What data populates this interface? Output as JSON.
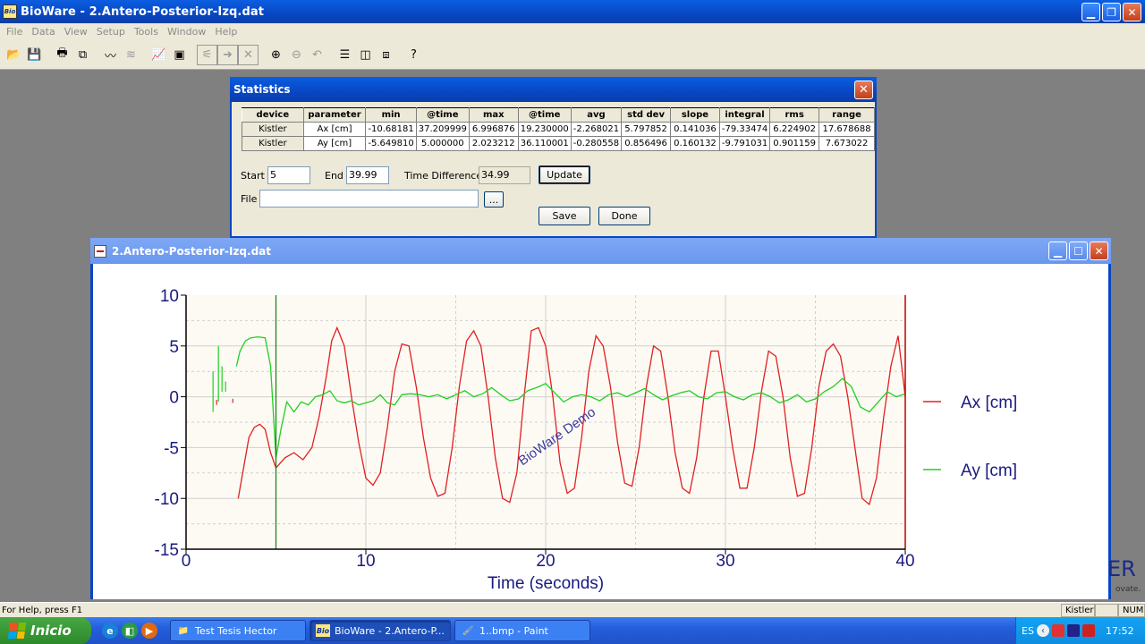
{
  "window": {
    "title": "BioWare - 2.Antero-Posterior-Izq.dat",
    "app_icon_text": "Bio"
  },
  "menu": [
    "File",
    "Data",
    "View",
    "Setup",
    "Tools",
    "Window",
    "Help"
  ],
  "statistics": {
    "title": "Statistics",
    "columns": [
      "device",
      "parameter",
      "min",
      "@time",
      "max",
      "@time",
      "avg",
      "std dev",
      "slope",
      "integral",
      "rms",
      "range"
    ],
    "rows": [
      [
        "Kistler",
        "Ax [cm]",
        "-10.68181",
        "37.209999",
        "6.996876",
        "19.230000",
        "-2.268021",
        "5.797852",
        "0.141036",
        "-79.33474",
        "6.224902",
        "17.678688"
      ],
      [
        "Kistler",
        "Ay [cm]",
        "-5.649810",
        "5.000000",
        "2.023212",
        "36.110001",
        "-0.280558",
        "0.856496",
        "0.160132",
        "-9.791031",
        "0.901159",
        "7.673022"
      ]
    ],
    "start_label": "Start",
    "start_value": "5",
    "end_label": "End",
    "end_value": "39.99",
    "time_diff_label": "Time Difference",
    "time_diff_value": "34.99",
    "update_label": "Update",
    "file_label": "File",
    "file_value": "",
    "browse_label": "...",
    "save_label": "Save",
    "done_label": "Done"
  },
  "plot_window": {
    "title": "2.Antero-Posterior-Izq.dat",
    "partial_logo": "ER",
    "partial_tagline": "ovate."
  },
  "chart_data": {
    "type": "line",
    "xlabel": "Time (seconds)",
    "ylabel": "",
    "xlim": [
      0,
      40
    ],
    "ylim": [
      -15,
      10
    ],
    "xticks": [
      0,
      10,
      20,
      30,
      40
    ],
    "yticks": [
      10,
      5,
      0,
      -5,
      -10,
      -15
    ],
    "grid": true,
    "legend": "right",
    "watermark": "BioWare Demo",
    "cursors": [
      5,
      40
    ],
    "series": [
      {
        "name": "Ax [cm]",
        "color": "#e02020",
        "x": [
          2.9,
          3.2,
          3.5,
          3.8,
          4.1,
          4.4,
          4.7,
          5.0,
          5.5,
          6.0,
          6.5,
          7.0,
          7.4,
          7.8,
          8.1,
          8.4,
          8.8,
          9.2,
          9.6,
          10.0,
          10.4,
          10.8,
          11.2,
          11.6,
          12.0,
          12.4,
          12.8,
          13.2,
          13.6,
          14.0,
          14.4,
          14.8,
          15.2,
          15.6,
          16.0,
          16.4,
          16.8,
          17.2,
          17.6,
          18.0,
          18.4,
          18.8,
          19.2,
          19.6,
          20.0,
          20.4,
          20.8,
          21.2,
          21.6,
          22.0,
          22.4,
          22.8,
          23.2,
          23.6,
          24.0,
          24.4,
          24.8,
          25.2,
          25.6,
          26.0,
          26.4,
          26.8,
          27.2,
          27.6,
          28.0,
          28.4,
          28.8,
          29.2,
          29.6,
          30.0,
          30.4,
          30.8,
          31.2,
          31.6,
          32.0,
          32.4,
          32.8,
          33.2,
          33.6,
          34.0,
          34.4,
          34.8,
          35.2,
          35.6,
          36.0,
          36.4,
          36.8,
          37.2,
          37.6,
          38.0,
          38.4,
          38.8,
          39.2,
          39.6,
          40.0
        ],
        "y": [
          -10.0,
          -7.0,
          -4.0,
          -3.0,
          -2.7,
          -3.2,
          -5.5,
          -7.0,
          -6.0,
          -5.5,
          -6.2,
          -5.0,
          -2.0,
          2.0,
          5.5,
          6.8,
          5.0,
          0.0,
          -4.5,
          -8.0,
          -8.7,
          -7.5,
          -3.0,
          2.5,
          5.2,
          5.0,
          1.0,
          -4.0,
          -8.0,
          -9.8,
          -9.5,
          -5.0,
          1.0,
          5.5,
          6.5,
          5.0,
          0.0,
          -6.0,
          -10.0,
          -10.4,
          -7.5,
          0.0,
          6.5,
          6.8,
          5.0,
          0.0,
          -6.5,
          -9.5,
          -9.0,
          -4.0,
          2.5,
          6.0,
          5.0,
          1.0,
          -4.5,
          -8.5,
          -8.8,
          -5.0,
          1.0,
          5.0,
          4.5,
          0.0,
          -5.5,
          -9.0,
          -9.5,
          -6.0,
          0.0,
          4.5,
          4.5,
          0.0,
          -5.0,
          -9.0,
          -9.0,
          -5.0,
          0.5,
          4.5,
          4.0,
          0.0,
          -6.0,
          -9.8,
          -9.5,
          -5.0,
          1.0,
          4.5,
          5.2,
          4.0,
          0.0,
          -5.0,
          -10.0,
          -10.6,
          -8.0,
          -2.0,
          3.0,
          6.0,
          0.0
        ]
      },
      {
        "name": "Ay [cm]",
        "color": "#20d020",
        "x": [
          2.8,
          3.0,
          3.3,
          3.6,
          4.0,
          4.4,
          4.7,
          5.0,
          5.3,
          5.6,
          6.0,
          6.4,
          6.8,
          7.2,
          7.6,
          8.0,
          8.4,
          8.8,
          9.2,
          9.6,
          10.0,
          10.4,
          10.8,
          11.2,
          11.6,
          12.0,
          12.5,
          13.0,
          13.5,
          14.0,
          14.5,
          15.0,
          15.5,
          16.0,
          16.5,
          17.0,
          17.5,
          18.0,
          18.5,
          19.0,
          19.5,
          20.0,
          20.5,
          21.0,
          21.5,
          22.0,
          22.5,
          23.0,
          23.5,
          24.0,
          24.5,
          25.0,
          25.5,
          26.0,
          26.5,
          27.0,
          27.5,
          28.0,
          28.5,
          29.0,
          29.5,
          30.0,
          30.5,
          31.0,
          31.5,
          32.0,
          32.5,
          33.0,
          33.5,
          34.0,
          34.5,
          35.0,
          35.5,
          36.0,
          36.5,
          37.0,
          37.5,
          38.0,
          38.5,
          39.0,
          39.5,
          40.0
        ],
        "y": [
          3.0,
          4.5,
          5.5,
          5.8,
          5.9,
          5.8,
          3.0,
          -6.0,
          -3.0,
          -0.5,
          -1.5,
          -0.5,
          -0.8,
          0.0,
          0.2,
          0.6,
          -0.4,
          -0.6,
          -0.4,
          -0.8,
          -0.6,
          -0.4,
          0.2,
          -0.6,
          -0.8,
          0.2,
          0.3,
          0.2,
          0.0,
          0.2,
          -0.2,
          0.2,
          0.6,
          0.0,
          0.3,
          0.9,
          0.2,
          -0.4,
          -0.2,
          0.6,
          0.9,
          1.3,
          0.4,
          -0.5,
          0.0,
          0.2,
          0.0,
          -0.4,
          0.2,
          0.4,
          0.0,
          0.4,
          0.8,
          0.2,
          -0.3,
          0.1,
          0.4,
          0.6,
          0.0,
          -0.2,
          0.4,
          0.5,
          0.0,
          -0.3,
          0.2,
          0.4,
          0.0,
          -0.6,
          -0.3,
          0.2,
          -0.5,
          -0.2,
          0.5,
          1.0,
          1.8,
          1.0,
          -1.0,
          -1.5,
          -0.5,
          0.5,
          0.0,
          0.3
        ]
      }
    ],
    "early_spikes": [
      {
        "color": "#20d020",
        "x": [
          1.5,
          1.8,
          2.0,
          2.2
        ],
        "ytop": [
          2.5,
          5.0,
          3.0,
          1.5
        ],
        "ybot": [
          -1.5,
          -0.5,
          0.5,
          0.5
        ]
      },
      {
        "color": "#e02020",
        "x": [
          1.7,
          2.6
        ],
        "ytop": [
          -0.3,
          -0.2
        ],
        "ybot": [
          -0.8,
          -0.6
        ]
      }
    ]
  },
  "status": {
    "help": "For Help, press F1",
    "device": "Kistler",
    "indicator": "NUM"
  },
  "taskbar": {
    "start_label": "Inicio",
    "tasks": [
      {
        "label": "Test Tesis Hector",
        "active": false
      },
      {
        "label": "BioWare - 2.Antero-P...",
        "active": true
      },
      {
        "label": "1..bmp - Paint",
        "active": false
      }
    ],
    "lang": "ES",
    "clock": "17:52"
  }
}
